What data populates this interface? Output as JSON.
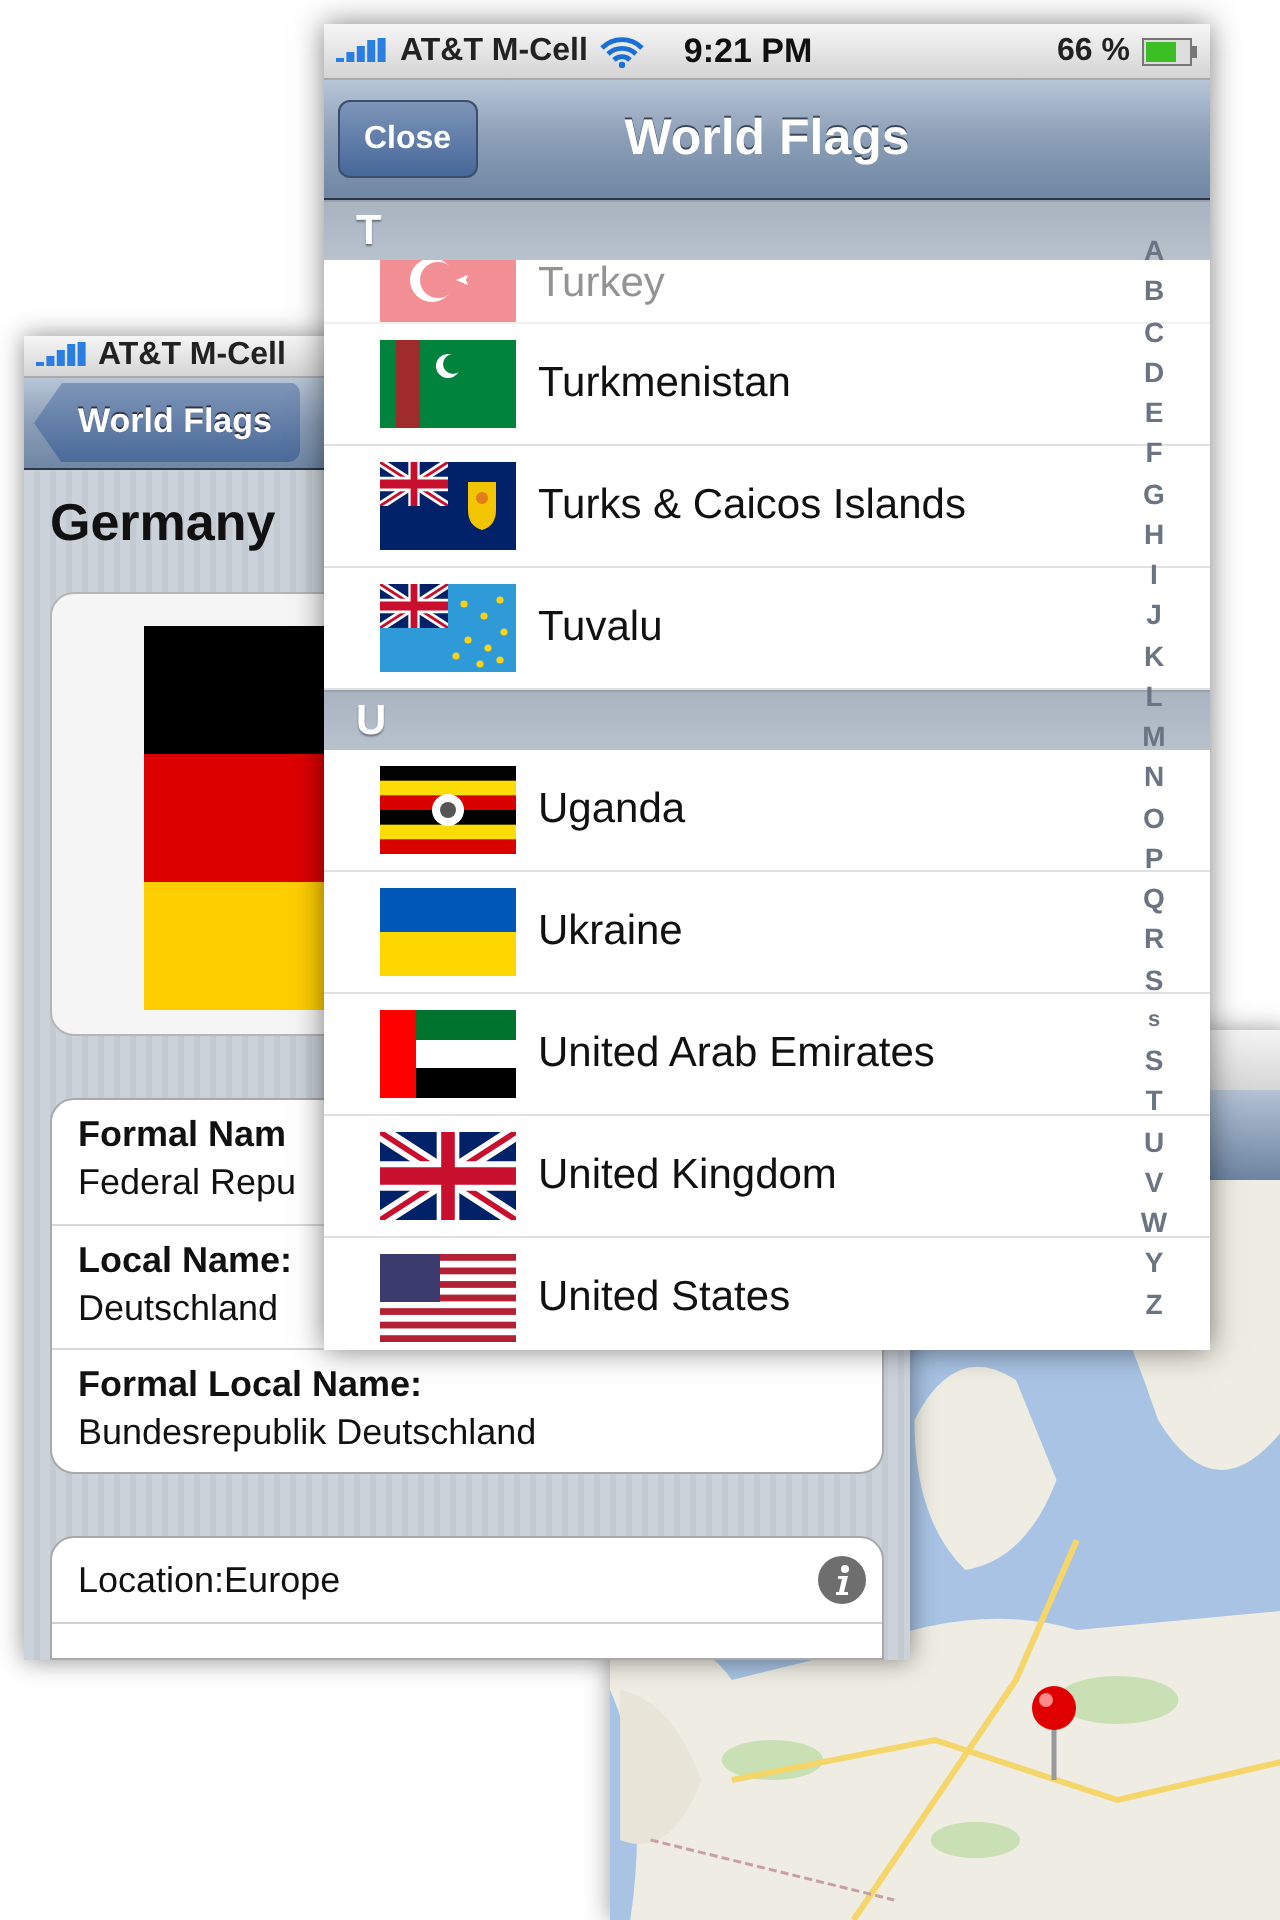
{
  "detail_screen": {
    "status_bar": {
      "carrier": "AT&T M-Cell"
    },
    "back_button": "World Flags",
    "title": "Germany",
    "info_rows": [
      {
        "label": "Formal Nam",
        "value": "Federal Repu"
      },
      {
        "label": "Local Name:",
        "value": "Deutschland"
      },
      {
        "label": "Formal Local Name:",
        "value": "Bundesrepublik Deutschland"
      }
    ],
    "location": "Location:Europe"
  },
  "list_screen": {
    "status_bar": {
      "carrier": "AT&T M-Cell",
      "time": "9:21 PM",
      "battery": "66 %"
    },
    "close_button": "Close",
    "title": "World Flags",
    "sections": [
      {
        "header": "T",
        "countries": [
          "Turkey",
          "Turkmenistan",
          "Turks & Caicos Islands",
          "Tuvalu"
        ]
      },
      {
        "header": "U",
        "countries": [
          "Uganda",
          "Ukraine",
          "United Arab Emirates",
          "United Kingdom",
          "United States"
        ]
      }
    ],
    "index": [
      "A",
      "B",
      "C",
      "D",
      "E",
      "F",
      "G",
      "H",
      "I",
      "J",
      "K",
      "L",
      "M",
      "N",
      "O",
      "P",
      "Q",
      "R",
      "S",
      "s",
      "S",
      "T",
      "U",
      "V",
      "W",
      "Y",
      "Z"
    ]
  }
}
